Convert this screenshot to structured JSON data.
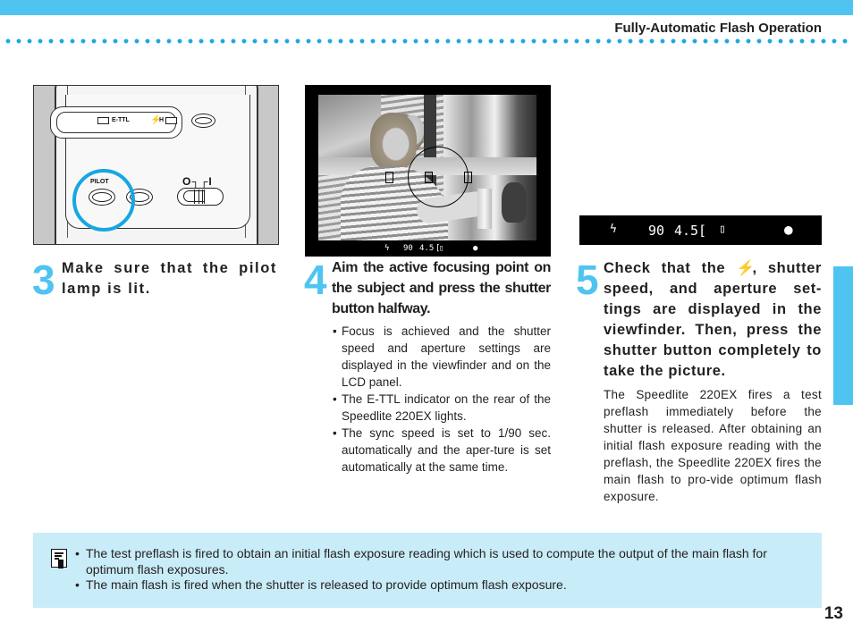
{
  "header": {
    "section_title": "Fully-Automatic Flash Operation"
  },
  "illustrations": {
    "flash_rear": {
      "indicator_label_ettl": "E-TTL",
      "indicator_label_flash_h": "H",
      "pilot_label": "PILOT",
      "switch_marks": "O┐┌I",
      "highlight_color": "#16a7e0"
    },
    "viewfinder": {
      "flash_symbol": "ϟ",
      "shutter_speed": "90",
      "aperture": "4.5",
      "focus_confirm": "●"
    },
    "lcd_panel": {
      "flash_symbol": "ϟ",
      "shutter_speed": "90",
      "aperture": "4.5",
      "focus_confirm": "●"
    }
  },
  "steps": [
    {
      "number": "3",
      "title": "Make sure that the pilot lamp is lit."
    },
    {
      "number": "4",
      "title": "Aim the active focusing point on the subject and press the shutter button halfway.",
      "bullets": [
        "Focus is achieved and the shutter speed and aperture settings are displayed in the viewfinder and on the LCD panel.",
        "The E-TTL indicator on the rear of the Speedlite 220EX lights.",
        "The sync speed is set to 1/90 sec. automatically and the aper-ture is set automatically at the same time."
      ]
    },
    {
      "number": "5",
      "title_before_icon": "Check that the",
      "title_icon": "flash-icon",
      "title_after_icon": ", shutter speed, and aperture set-tings are displayed in the viewfinder. Then, press the shutter button completely to take the picture.",
      "paragraph": "The Speedlite 220EX fires a test preflash immediately before the shutter is released. After obtaining an initial flash exposure reading with the preflash, the Speedlite 220EX fires the main flash to pro-vide optimum flash exposure."
    }
  ],
  "note": {
    "icon": "memo-icon",
    "items": [
      "The test preflash is fired to obtain an initial flash exposure reading which is used to compute the output of the main flash for optimum flash exposures.",
      "The main flash is fired when the shutter is released to provide optimum flash exposure."
    ]
  },
  "footer": {
    "page_number": "13"
  },
  "colors": {
    "accent_blue": "#4fc4f1",
    "note_background": "#c9ecf9",
    "dot_blue": "#1aa8e6"
  }
}
